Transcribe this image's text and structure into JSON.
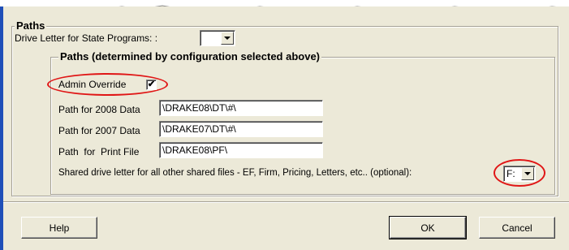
{
  "paths_group": {
    "title": "Paths",
    "drive_letter_label": "Drive Letter for State Programs: :",
    "drive_letter_value": ""
  },
  "config_group": {
    "title": "Paths (determined by configuration selected above)",
    "admin_override_label": "Admin Override",
    "admin_override_checked": true,
    "check_glyph": "✔",
    "fields": [
      {
        "label": "Path for 2008 Data",
        "value": "\\DRAKE08\\DT\\#\\"
      },
      {
        "label": "Path for 2007 Data",
        "value": "\\DRAKE07\\DT\\#\\"
      },
      {
        "label": "Path  for  Print File",
        "value": "\\DRAKE08\\PF\\"
      }
    ],
    "shared_drive_label": "Shared drive letter for all other shared files - EF, Firm, Pricing, Letters, etc.. (optional):",
    "shared_drive_value": "F:"
  },
  "buttons": {
    "help": "Help",
    "ok": "OK",
    "cancel": "Cancel"
  },
  "colors": {
    "dialog_bg": "#ece9d8",
    "highlight": "#e01616",
    "titlebar_edge": "#1f4fb8"
  }
}
